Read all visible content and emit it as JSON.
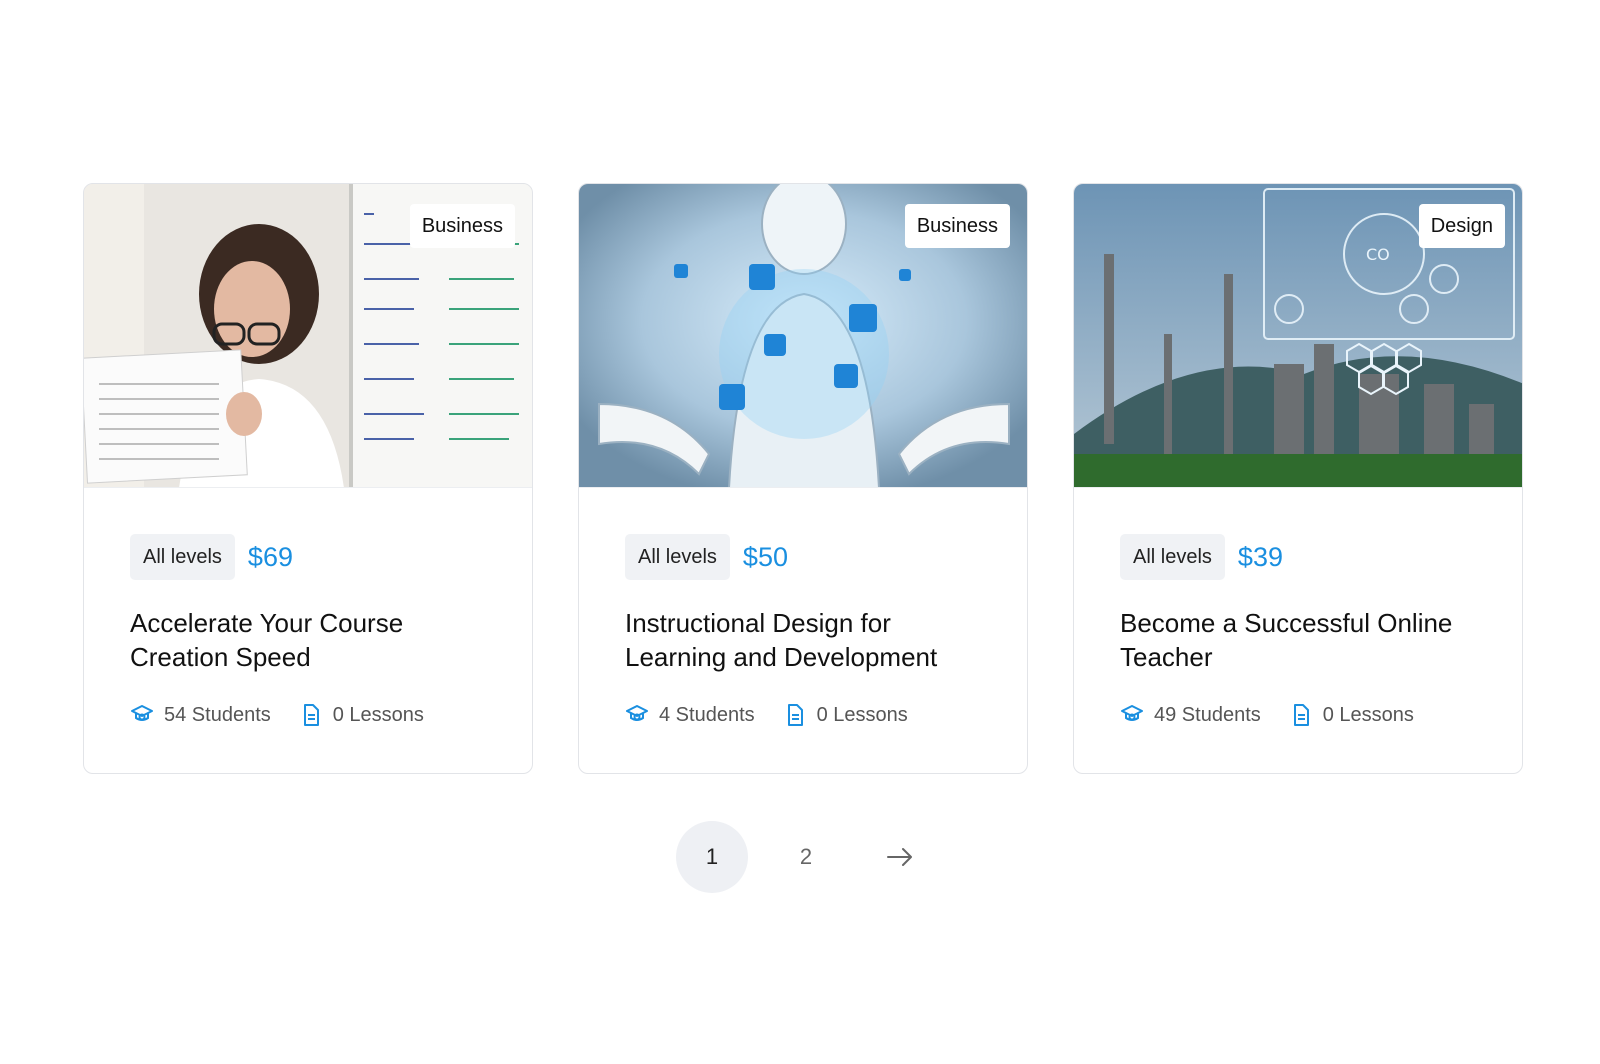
{
  "courses": [
    {
      "category": "Business",
      "level": "All levels",
      "price": "$69",
      "title": "Accelerate Your Course Creation Speed",
      "students": "54 Students",
      "lessons": "0 Lessons"
    },
    {
      "category": "Business",
      "level": "All levels",
      "price": "$50",
      "title": "Instructional Design for Learning and Development",
      "students": "4 Students",
      "lessons": "0 Lessons"
    },
    {
      "category": "Design",
      "level": "All levels",
      "price": "$39",
      "title": "Become a Successful Online Teacher",
      "students": "49 Students",
      "lessons": "0 Lessons"
    }
  ],
  "pagination": {
    "pages": [
      "1",
      "2"
    ],
    "current": "1",
    "next_icon": "arrow-right-icon"
  },
  "colors": {
    "accent": "#1a8fe0",
    "level_bg": "#f0f2f5",
    "active_page_bg": "#eef0f4"
  },
  "icons": {
    "students": "graduation-cap-icon",
    "lessons": "document-icon"
  }
}
